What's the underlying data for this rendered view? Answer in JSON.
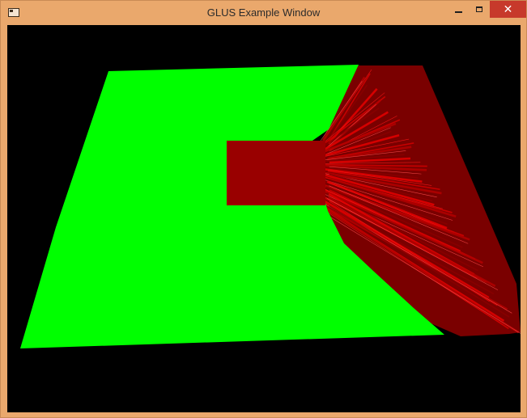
{
  "window": {
    "title": "GLUS Example Window",
    "controls": {
      "minimize_icon": "minimize-icon",
      "maximize_icon": "maximize-icon",
      "close_label": "✕"
    }
  },
  "scene": {
    "background_color": "#000000",
    "plane_color": "#00ff00",
    "block_color": "#990000",
    "streak_color": "#ff0000"
  }
}
